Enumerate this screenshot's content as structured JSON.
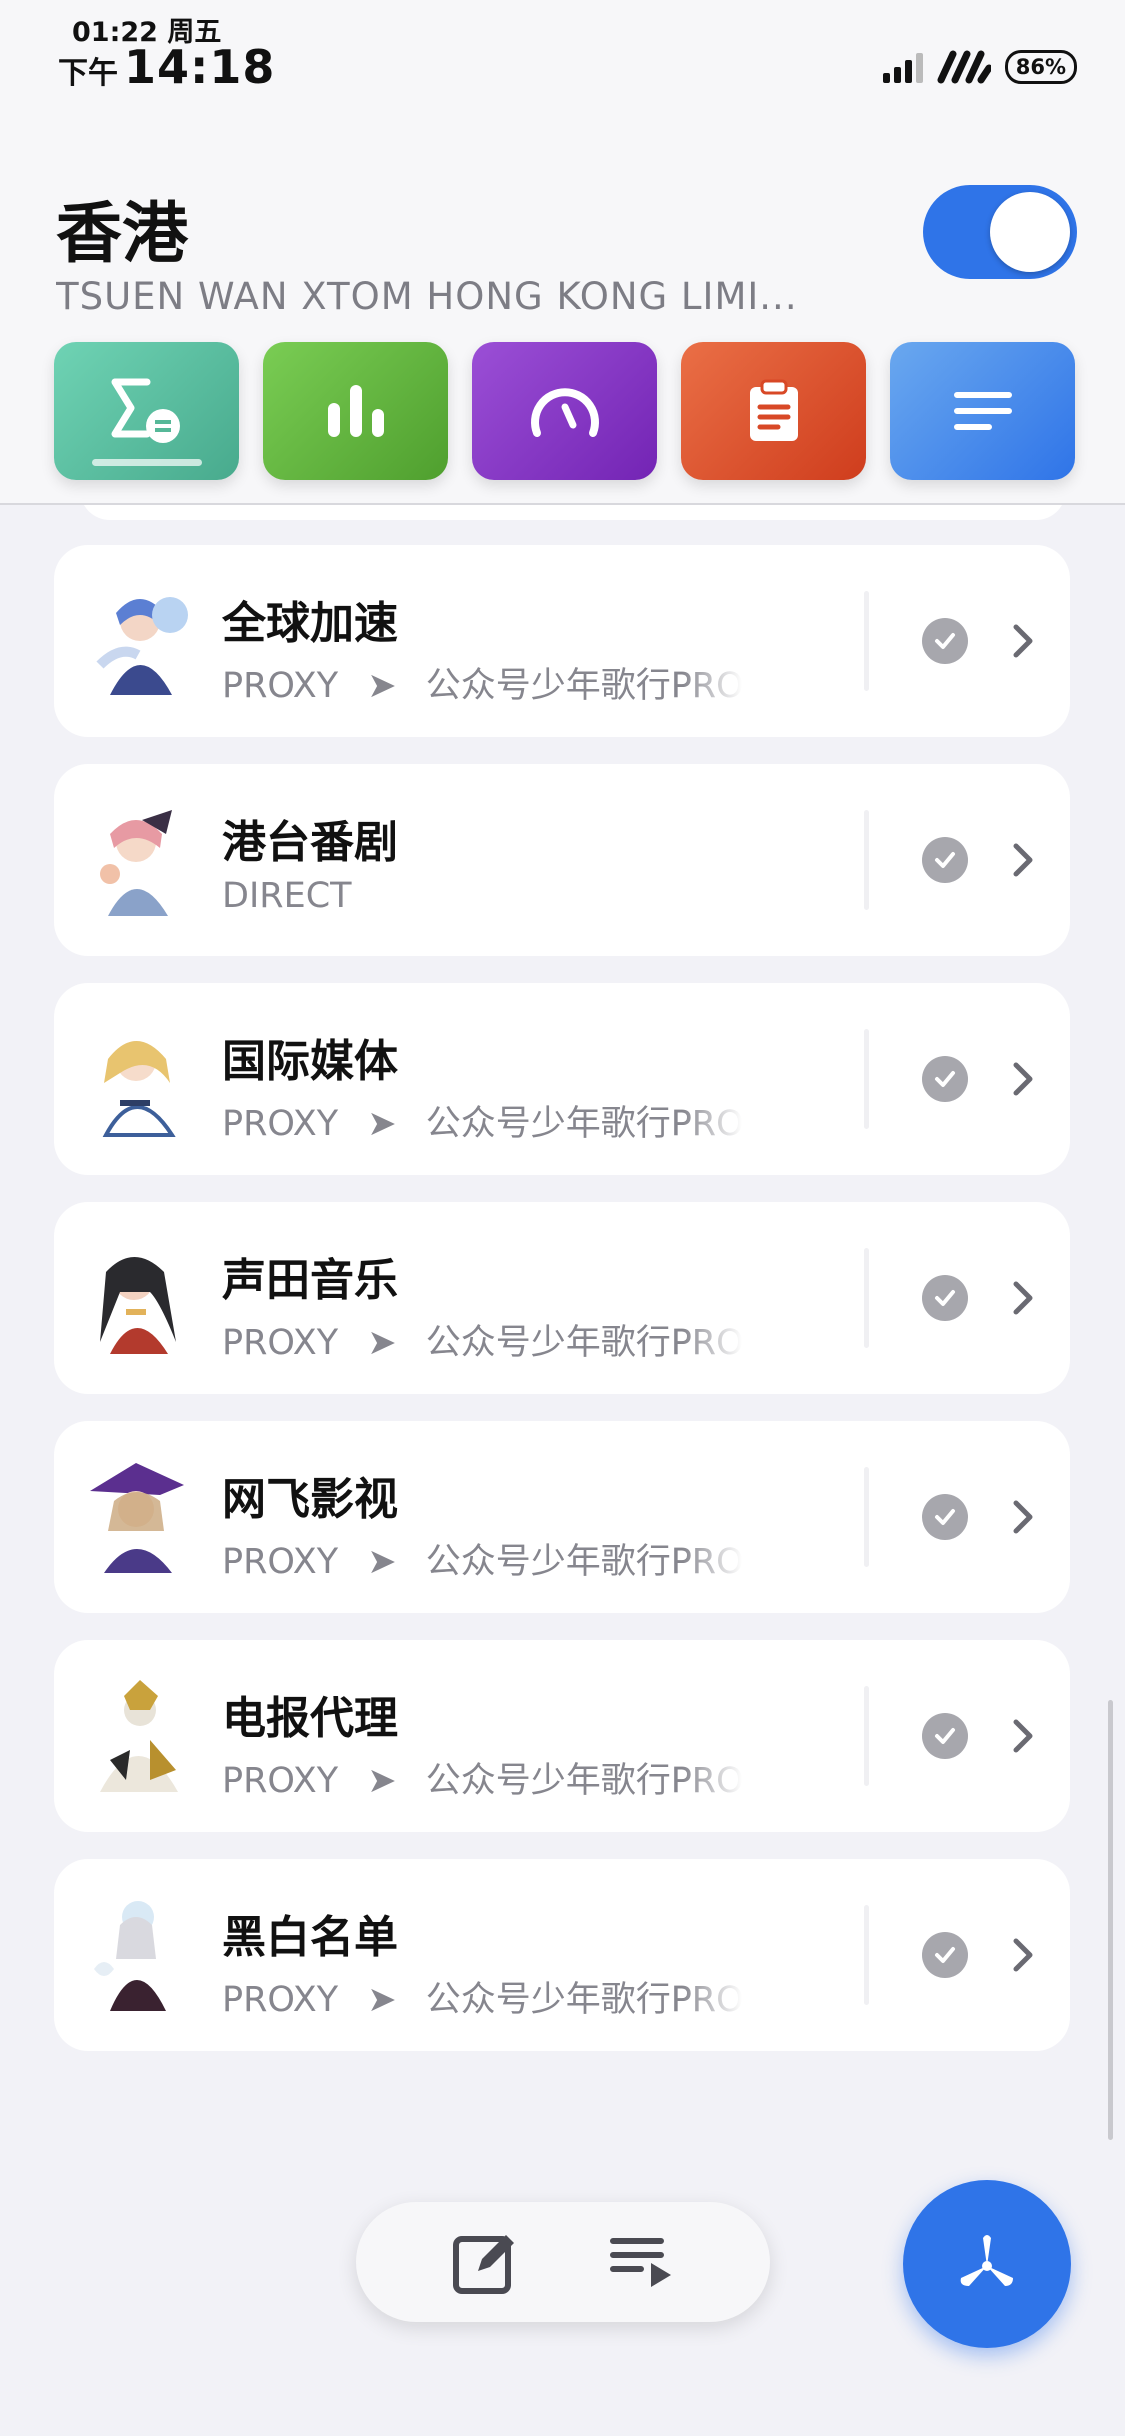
{
  "status_bar": {
    "date": "01:22 周五",
    "ampm": "下午",
    "time": "14:18",
    "battery": "86%"
  },
  "header": {
    "title": "香港",
    "subtitle": "TSUEN WAN XTOM HONG KONG LIMI...",
    "toggle_on": true
  },
  "tiles": [
    {
      "icon": "sigma-icon",
      "color": "#5bc3a2"
    },
    {
      "icon": "bar-chart-icon",
      "color": "#65b840"
    },
    {
      "icon": "speedometer-icon",
      "color": "#8a3ac8"
    },
    {
      "icon": "clipboard-icon",
      "color": "#e05530"
    },
    {
      "icon": "menu-lines-icon",
      "color": "#4a8eeb"
    }
  ],
  "groups": [
    {
      "name": "全球加速",
      "policy": "PROXY",
      "arrow": "➤",
      "node": "公众号少年歌行PRO赠送高"
    },
    {
      "name": "港台番剧",
      "policy": "DIRECT",
      "arrow": "",
      "node": ""
    },
    {
      "name": "国际媒体",
      "policy": "PROXY",
      "arrow": "➤",
      "node": "公众号少年歌行PRO赠送高"
    },
    {
      "name": "声田音乐",
      "policy": "PROXY",
      "arrow": "➤",
      "node": "公众号少年歌行PRO赠送高"
    },
    {
      "name": "网飞影视",
      "policy": "PROXY",
      "arrow": "➤",
      "node": "公众号少年歌行PRO赠送高"
    },
    {
      "name": "电报代理",
      "policy": "PROXY",
      "arrow": "➤",
      "node": "公众号少年歌行PRO赠送高"
    },
    {
      "name": "黑白名单",
      "policy": "PROXY",
      "arrow": "➤",
      "node": "公众号少年歌行PRO赠送高"
    }
  ],
  "bottom_bar": {
    "left_icon": "edit-icon",
    "right_icon": "playlist-icon"
  },
  "fab_icon": "fan-icon",
  "accent_color": "#2f74e8"
}
